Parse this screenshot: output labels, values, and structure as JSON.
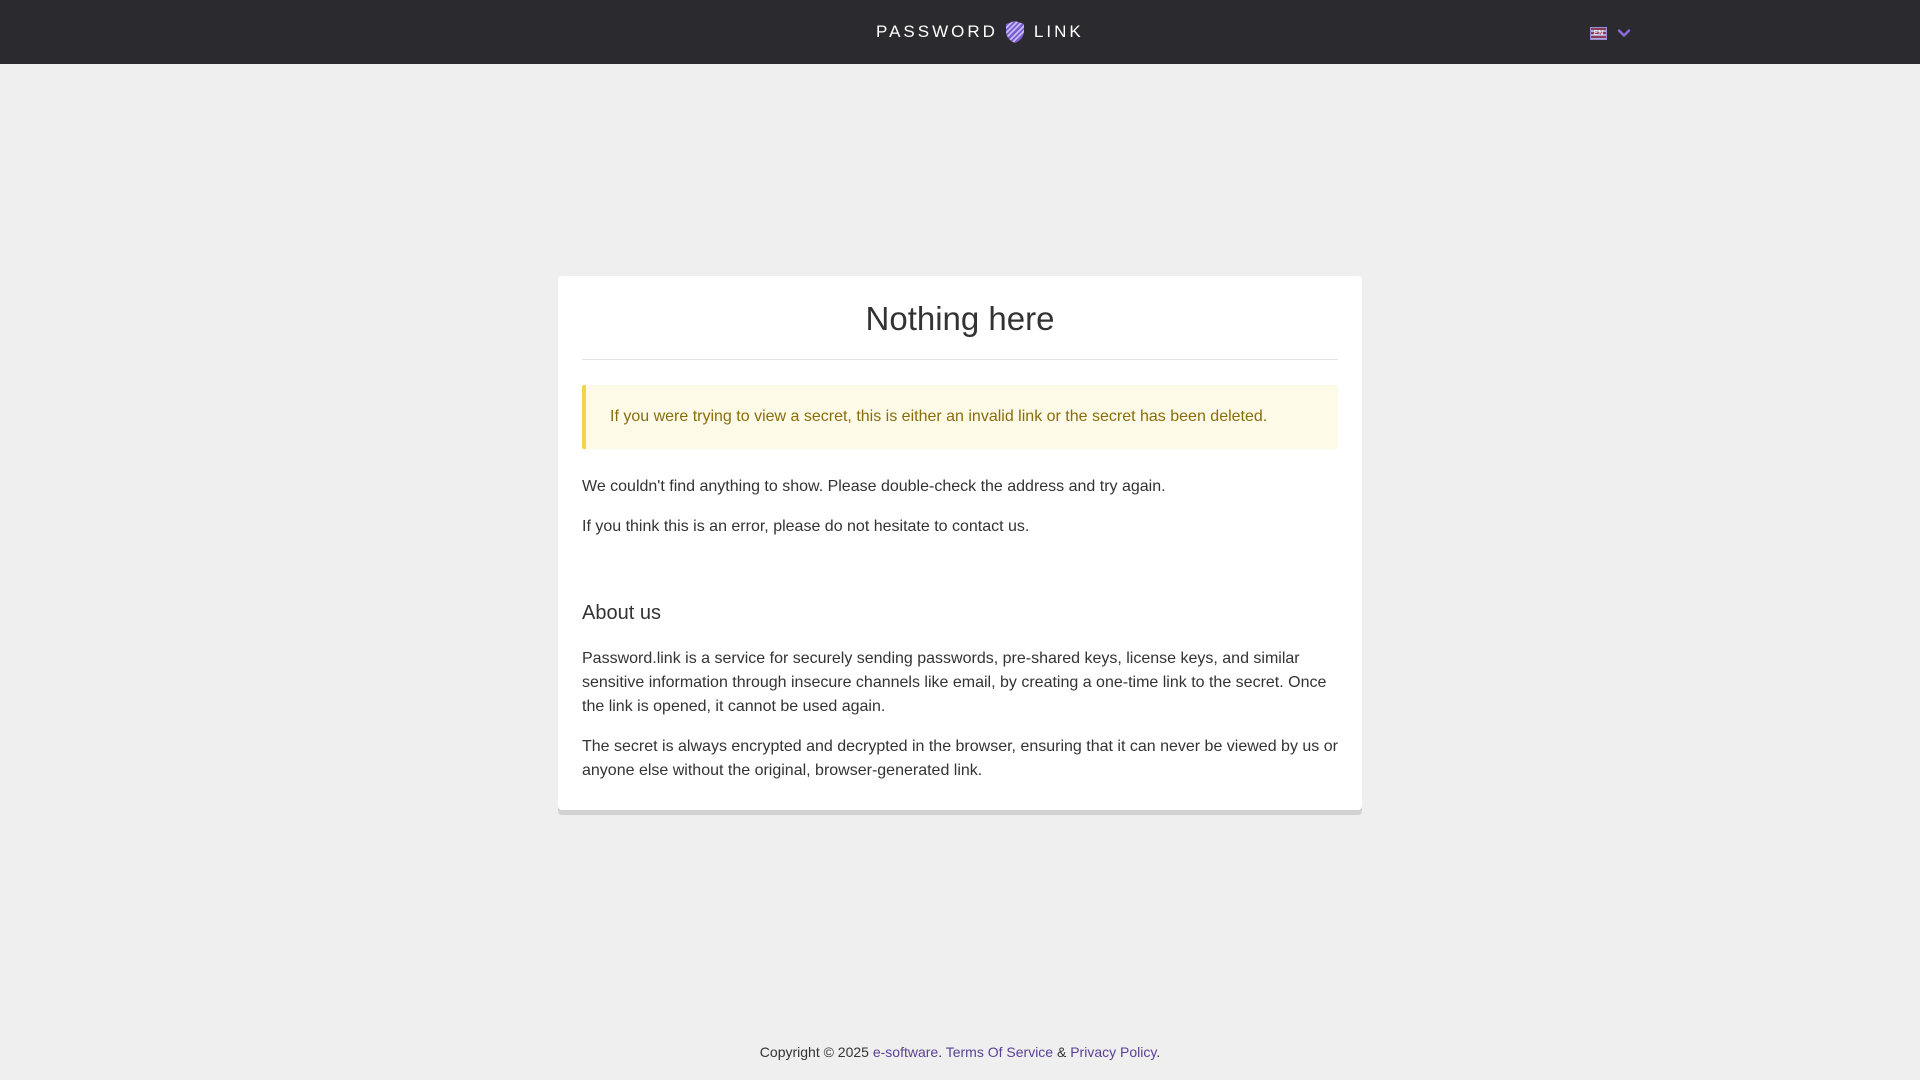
{
  "header": {
    "logo_left": "PASSWORD",
    "logo_right": "LINK",
    "logo_icon": "shield-icon",
    "language": {
      "selected": "EN",
      "icon": "chevron-down-icon"
    }
  },
  "card": {
    "title": "Nothing here",
    "alert": "If you were trying to view a secret, this is either an invalid link or the secret has been deleted.",
    "paragraph1": "We couldn't find anything to show. Please double-check the address and try again.",
    "paragraph2": "If you think this is an error, please do not hesitate to contact us.",
    "about_heading": "About us",
    "about_paragraph1": "Password.link is a service for securely sending passwords, pre-shared keys, license keys, and similar sensitive information through insecure channels like email, by creating a one-time link to the secret. Once the link is opened, it cannot be used again.",
    "about_paragraph2": "The secret is always encrypted and decrypted in the browser, ensuring that it can never be viewed by us or anyone else without the original, browser-generated link."
  },
  "footer": {
    "copyright": "Copyright © 2025",
    "company_link": "e-software",
    "period1": ".",
    "terms_link": "Terms Of Service",
    "ampersand": "&",
    "privacy_link": "Privacy Policy",
    "period2": "."
  },
  "colors": {
    "topbar": "#2b2b2f",
    "background": "#efefef",
    "accent": "#5b3f97",
    "alert_bg": "#fdfae8",
    "alert_border": "#f3d34a",
    "alert_text": "#8a6d0b"
  }
}
